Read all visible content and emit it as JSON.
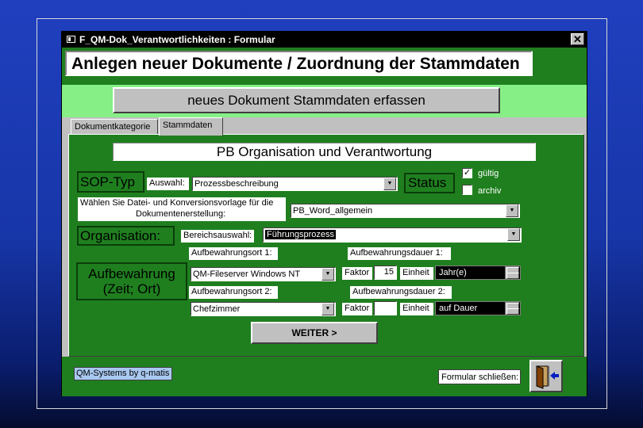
{
  "window": {
    "title": "F_QM-Dok_Verantwortlichkeiten : Formular",
    "close_glyph": "✕"
  },
  "header": {
    "title": "Anlegen neuer Dokumente / Zuordnung der Stammdaten"
  },
  "action_button": {
    "label": "neues Dokument Stammdaten erfassen"
  },
  "tabs": [
    {
      "label": "Dokumentkategorie"
    },
    {
      "label": "Stammdaten"
    }
  ],
  "banner": {
    "text": "PB Organisation und Verantwortung"
  },
  "sop": {
    "heading": "SOP-Typ",
    "select_label": "Auswahl:",
    "select_value": "Prozessbeschreibung"
  },
  "status": {
    "heading": "Status",
    "options": [
      {
        "label": "gültig",
        "checked": true,
        "mark": "✓"
      },
      {
        "label": "archiv",
        "checked": false,
        "mark": ""
      }
    ]
  },
  "template": {
    "label_line1": "Wählen Sie Datei- und Konversionsvorlage für die",
    "label_line2": "Dokumentenerstellung:",
    "value": "PB_Word_allgemein"
  },
  "organisation": {
    "heading": "Organisation:",
    "label": "Bereichsauswahl:",
    "value": "Führungsprozess"
  },
  "retention": {
    "heading_line1": "Aufbewahrung",
    "heading_line2": "(Zeit; Ort)",
    "place1": {
      "label": "Aufbewahrungsort 1:",
      "value": "QM-Fileserver Windows NT"
    },
    "duration1": {
      "label": "Aufbewahrungsdauer 1:",
      "factor_label": "Faktor",
      "factor_value": "15",
      "unit_label": "Einheit",
      "unit_value": "Jahr(e)"
    },
    "place2": {
      "label": "Aufbewahrungsort 2:",
      "value": "Chefzimmer"
    },
    "duration2": {
      "label": "Aufbewahrungsdauer 2:",
      "factor_label": "Faktor",
      "factor_value": "",
      "unit_label": "Einheit",
      "unit_value": "auf Dauer"
    }
  },
  "next_button": {
    "label": "WEITER >"
  },
  "footer": {
    "credit": "QM-Systems by q-matis",
    "close_label": "Formular schließen:"
  },
  "icons": {
    "dropdown": "▼",
    "exit": "exit-door-icon"
  },
  "colors": {
    "form_green": "#1f7f1f",
    "light_green": "#86ef86",
    "background_blue": "#1f3fbf"
  }
}
